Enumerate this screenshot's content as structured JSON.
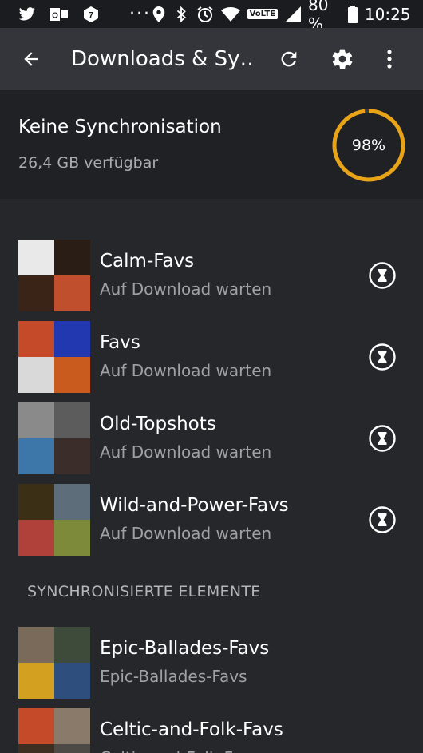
{
  "status_bar": {
    "left_icons": [
      "twitter-icon",
      "outlook-icon",
      "app7-icon"
    ],
    "more": "···",
    "volte": "VoLTE",
    "battery": "80 %",
    "time": "10:25"
  },
  "toolbar": {
    "title": "Downloads & Sy…"
  },
  "sync": {
    "title": "Keine Synchronisation",
    "subtitle": "26,4 GB verfügbar",
    "percent_label": "98%",
    "percent_value": 98,
    "ring_color": "#e8a317"
  },
  "pending_items": [
    {
      "name": "Calm-Favs",
      "status": "Auf Download warten",
      "tiles": [
        "#e9e9e9",
        "#2a1d16",
        "#3a2418",
        "#c0502d"
      ]
    },
    {
      "name": "Favs",
      "status": "Auf Download warten",
      "tiles": [
        "#c44a2a",
        "#2238b0",
        "#d9d9d9",
        "#c95b1f"
      ]
    },
    {
      "name": "Old-Topshots",
      "status": "Auf Download warten",
      "tiles": [
        "#8a8a8a",
        "#5c5c5c",
        "#3d76a8",
        "#3a2d2a"
      ]
    },
    {
      "name": "Wild-and-Power-Favs",
      "status": "Auf Download warten",
      "tiles": [
        "#3b3015",
        "#5d6e7a",
        "#b0403a",
        "#7d8a3a"
      ]
    }
  ],
  "section_synced": "SYNCHRONISIERTE ELEMENTE",
  "synced_items": [
    {
      "name": "Epic-Ballades-Favs",
      "status": "Epic-Ballades-Favs",
      "tiles": [
        "#7a6a5a",
        "#3e4a3a",
        "#d4a020",
        "#2e4f7d"
      ]
    },
    {
      "name": "Celtic-and-Folk-Favs",
      "status": "Celtic-and-Folk-Favs",
      "tiles": [
        "#c44a2a",
        "#8a7a6a",
        "#3f2e22",
        "#4d4a45"
      ]
    }
  ],
  "colors": {
    "background": "#26272b",
    "toolbar": "#33353a",
    "panel": "#202124",
    "accent": "#e8a317"
  }
}
